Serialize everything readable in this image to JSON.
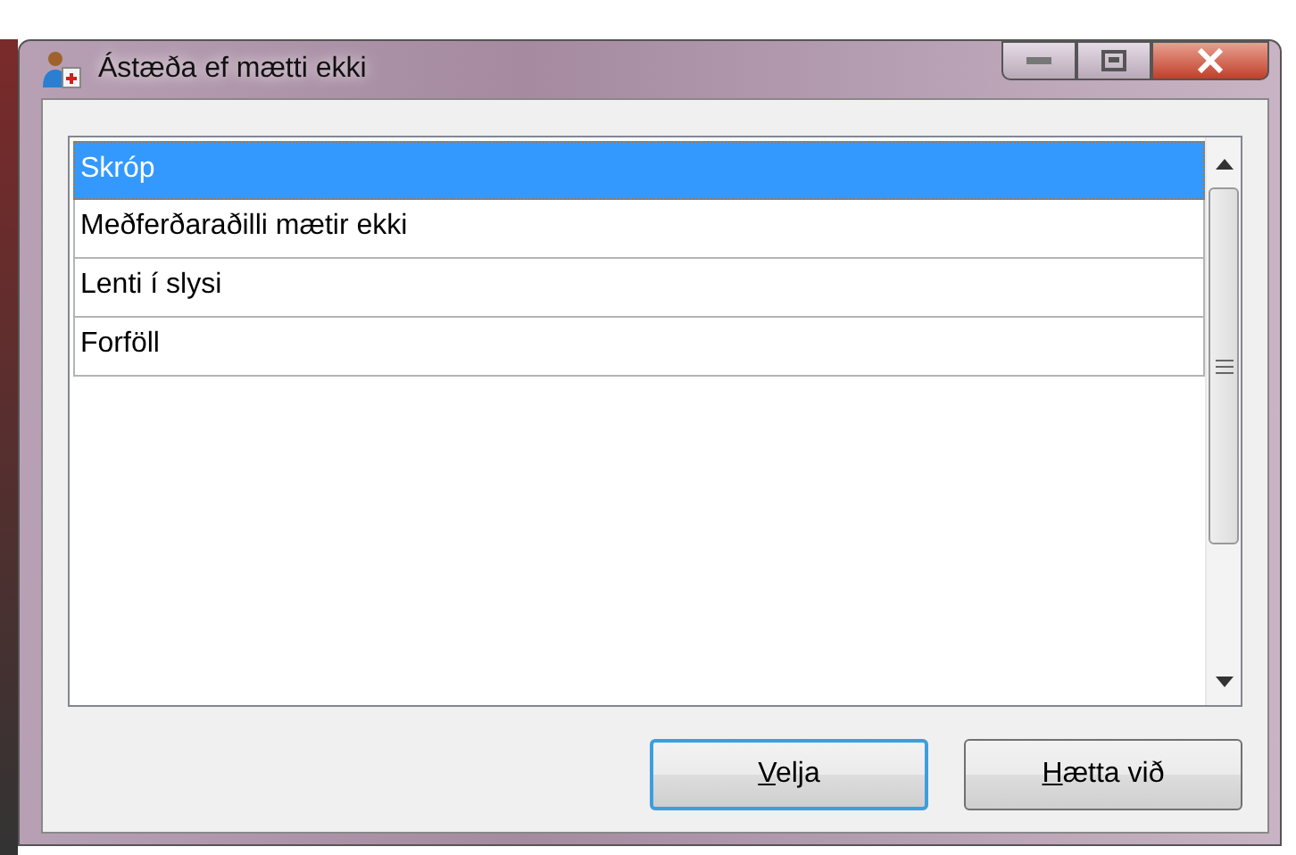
{
  "window": {
    "title": "Ástæða ef mætti ekki"
  },
  "list": {
    "items": [
      {
        "label": "Skróp",
        "selected": true
      },
      {
        "label": "Meðferðaraðilli mætir ekki",
        "selected": false
      },
      {
        "label": "Lenti í slysi",
        "selected": false
      },
      {
        "label": "Forföll",
        "selected": false
      }
    ]
  },
  "buttons": [
    {
      "access_key": "V",
      "label_rest": "elja",
      "default": true
    },
    {
      "access_key": "H",
      "label_rest": "ætta við",
      "default": false
    }
  ]
}
